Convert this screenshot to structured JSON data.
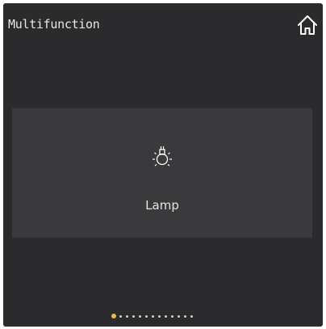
{
  "header": {
    "title": "Multifunction",
    "home_icon": "home-icon"
  },
  "tile": {
    "icon": "lamp-icon",
    "label": "Lamp"
  },
  "pager": {
    "count": 13,
    "active_index": 0
  },
  "colors": {
    "background": "#2b2b2d",
    "tile": "#3a3a3c",
    "active_dot": "#e8b75a",
    "text": "#e8e8e8"
  }
}
